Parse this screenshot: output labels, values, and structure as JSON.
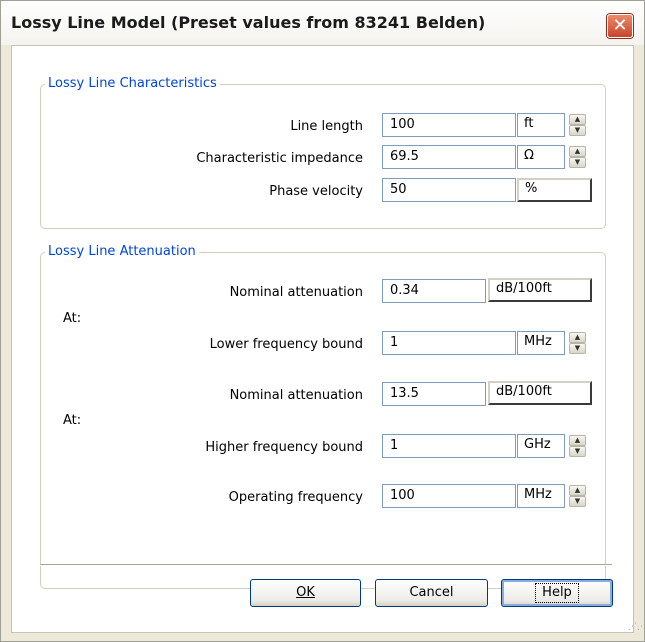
{
  "window": {
    "title": "Lossy Line Model (Preset values from 83241 Belden)"
  },
  "characteristics": {
    "legend": "Lossy Line  Characteristics",
    "rows": [
      {
        "label": "Line length",
        "value": "100",
        "unit": "ft"
      },
      {
        "label": "Characteristic impedance",
        "value": "69.5",
        "unit": "Ω"
      },
      {
        "label": "Phase velocity",
        "value": "50",
        "unit": "%"
      }
    ]
  },
  "attenuation": {
    "legend": "Lossy Line Attenuation",
    "at_label": "At:",
    "rows": [
      {
        "label": "Nominal attenuation",
        "value": "0.34",
        "unit": "dB/100ft"
      },
      {
        "label": "Lower frequency bound",
        "value": "1",
        "unit": "MHz"
      },
      {
        "label": "Nominal attenuation",
        "value": "13.5",
        "unit": "dB/100ft"
      },
      {
        "label": "Higher frequency bound",
        "value": "1",
        "unit": "GHz"
      },
      {
        "label": "Operating frequency",
        "value": "100",
        "unit": "MHz"
      }
    ]
  },
  "buttons": {
    "ok": "OK",
    "cancel": "Cancel",
    "help": "Help"
  },
  "icons": {
    "close": "close-icon",
    "spin": "spin-arrows-icon",
    "grip": "resize-grip-icon"
  },
  "colors": {
    "legend_text": "#0046d5",
    "close_button": "#c9452a",
    "dialog_face": "#ece9d8"
  }
}
